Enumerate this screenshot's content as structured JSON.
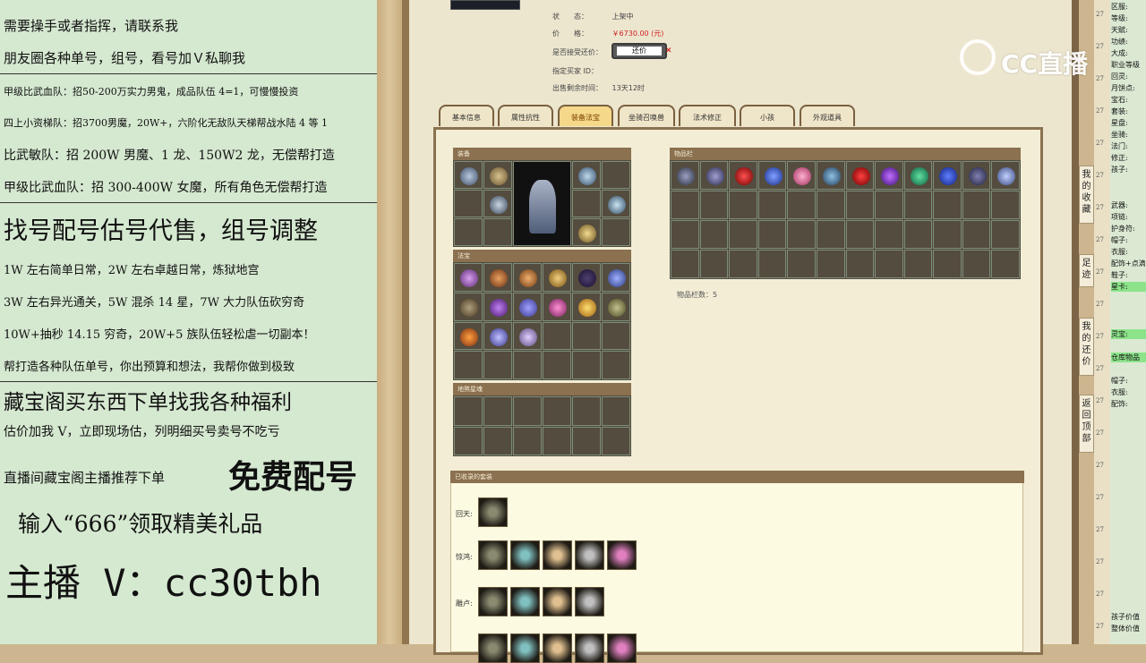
{
  "overlay": {
    "lines": [
      "需要操手或者指挥，请联系我",
      "朋友圈各种单号，组号，看号加Ｖ私聊我",
      "甲级比武血队：招50-200万实力男鬼，成品队伍 4=1，可慢慢投资",
      "四上小资梯队：招3700男魔，20W+，六阶化无敌队天梯帮战水陆 4 等 1",
      "比武敏队：招 200W 男魔、1 龙、150W2 龙，无偿帮打造",
      "甲级比武血队：招 300-400W 女魔，所有角色无偿帮打造",
      "找号配号估号代售，组号调整",
      "1W 左右简单日常，2W 左右卓越日常，炼狱地宫",
      "3W 左右异光通关，5W 混杀 14 星，7W 大力队伍砍穷奇",
      "10W+抽秒 14.15 穷奇，20W+5 族队伍轻松虐一切副本！",
      "帮打造各种队伍单号，你出预算和想法，我帮你做到极致",
      "藏宝阁买东西下单找我各种福利",
      "估价加我 V，立即现场估，列明细买号卖号不吃亏",
      "直播间藏宝阁主播推荐下单",
      "免费配号",
      "输入“666”领取精美礼品",
      "主播 V：cc30tbh"
    ]
  },
  "item_info": {
    "status_label": "状　　态：",
    "status_value": "上架中",
    "price_label": "价　　格：",
    "price_value": "￥6730.00 (元)",
    "haggle_label": "是否接受还价：",
    "haggle_button": "还价",
    "buyer_label": "指定买家 ID：",
    "remaining_label": "出售剩余时间：",
    "remaining_value": "13天12时"
  },
  "tabs": [
    "基本信息",
    "属性抗性",
    "装备法宝",
    "坐骑召唤兽",
    "法术修正",
    "小孩",
    "外观道具"
  ],
  "sections": {
    "equipment": "装备",
    "fabao": "法宝",
    "dihun": "地煞星魂",
    "inventory": "物品栏",
    "inventory_count": "物品栏数：5",
    "sets": "已收录的套装"
  },
  "sets": {
    "huitian": "回天:",
    "jinghong": "惊鸿:",
    "diaolu": "雕卢:"
  },
  "side_buttons": [
    "我的收藏",
    "足迹",
    "我的还价",
    "返回顶部"
  ],
  "right_panel": {
    "labels": [
      "区服:",
      "等级:",
      "天赋:",
      "功绩:",
      "大成:",
      "职业等级",
      "回灵:",
      "月饼点:",
      "宝石:",
      "套装:",
      "星盘:",
      "坐骑:",
      "法门:",
      "修正:",
      "孩子:",
      "武器:",
      "项链:",
      "护身符:",
      "帽子:",
      "衣服:",
      "配饰+点滴",
      "鞋子:",
      "星卡:",
      "灵宝:",
      "仓库物品",
      "帽子:",
      "衣服:",
      "配饰:",
      "孩子价值",
      "整体价值"
    ],
    "numbers": [
      "27",
      "27",
      "27",
      "27",
      "27",
      "27",
      "27",
      "27",
      "27",
      "27",
      "27",
      "27",
      "27",
      "27",
      "27",
      "27",
      "27",
      "27",
      "27",
      "27"
    ]
  },
  "watermark": "CC直播",
  "colors": {
    "overlay_bg": "#d5e8d0",
    "price": "#d02020",
    "active_tab": "#f5d889",
    "highlight": "#8ce38a"
  }
}
